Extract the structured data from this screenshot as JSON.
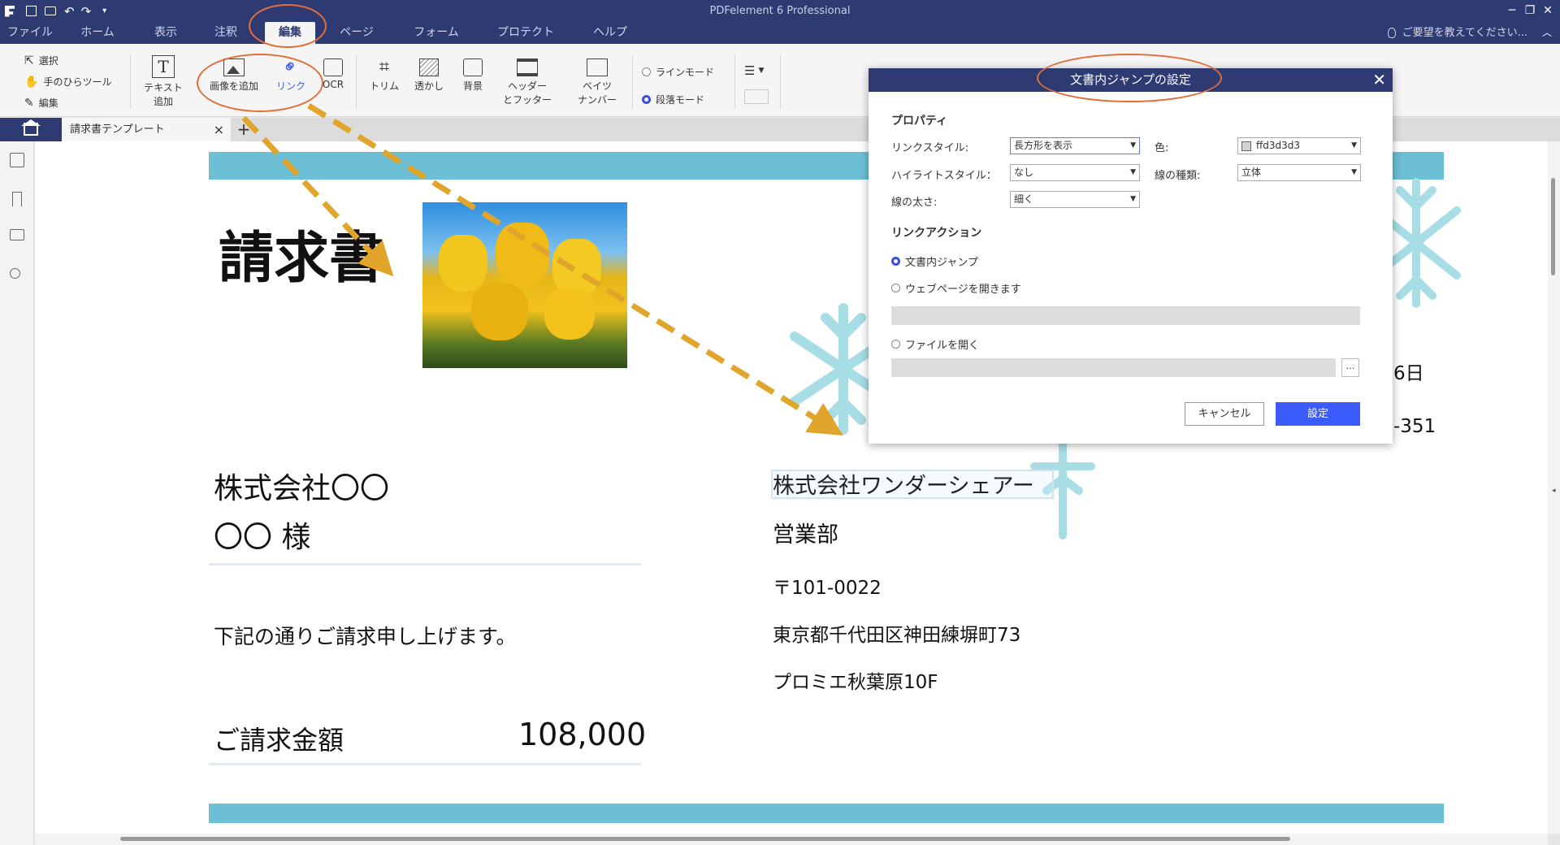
{
  "window": {
    "title": "PDFelement 6 Professional",
    "minimize": "─",
    "maximize": "❐",
    "close": "✕"
  },
  "menu": {
    "tabs": [
      "ファイル",
      "ホーム",
      "表示",
      "注釈",
      "編集",
      "ページ",
      "フォーム",
      "プロテクト",
      "ヘルプ"
    ],
    "active": "編集",
    "help_hint": "ご要望を教えてください..."
  },
  "ribbon": {
    "select": "選択",
    "hand_tool": "手のひらツール",
    "edit": "編集",
    "add_text_line1": "テキスト",
    "add_text_line2": "追加",
    "add_image": "画像を追加",
    "link": "リンク",
    "ocr": "OCR",
    "trim": "トリム",
    "watermark": "透かし",
    "background": "背景",
    "header_footer_line1": "ヘッダー",
    "header_footer_line2": "とフッター",
    "bates_line1": "ベイツ",
    "bates_line2": "ナンバー",
    "line_mode": "ラインモード",
    "paragraph_mode": "段落モード",
    "selected_mode": "段落モード"
  },
  "tabs": {
    "document": "請求書テンプレート",
    "close": "×",
    "add": "+"
  },
  "document": {
    "title": "請求書",
    "client_company": "株式会社〇〇",
    "client_name": "〇〇 様",
    "intro": "下記の通りご請求申し上げます。",
    "amount_label": "ご請求金額",
    "amount_value": "108,000",
    "date_fragment": "6日",
    "phone_fragment": "-351",
    "sender_company": "株式会社ワンダーシェアー",
    "sender_dept": "営業部",
    "postal": "〒101-0022",
    "address1": "東京都千代田区神田練塀町73",
    "address2": "プロミエ秋葉原10F"
  },
  "dialog": {
    "title": "文書内ジャンプの設定",
    "close": "✕",
    "properties_heading": "プロパティ",
    "link_style_label": "リンクスタイル:",
    "link_style_value": "長方形を表示",
    "color_label": "色:",
    "color_value": "ffd3d3d3",
    "color_swatch": "#d3d3d3",
    "highlight_label": "ハイライトスタイル：",
    "highlight_value": "なし",
    "line_type_label": "線の種類:",
    "line_type_value": "立体",
    "line_width_label": "線の太さ:",
    "line_width_value": "細く",
    "action_heading": "リンクアクション",
    "action_goto": "文書内ジャンプ",
    "action_web": "ウェブページを開きます",
    "action_file": "ファイルを開く",
    "selected_action": "文書内ジャンプ",
    "browse": "...",
    "cancel": "キャンセル",
    "ok": "設定"
  },
  "colors": {
    "title_bar": "#2e3b73",
    "accent_blue": "#3b5bfd",
    "page_band": "#6cbfd4",
    "annotation_orange": "#e36d3a",
    "annotation_arrow": "#e0a52a"
  }
}
